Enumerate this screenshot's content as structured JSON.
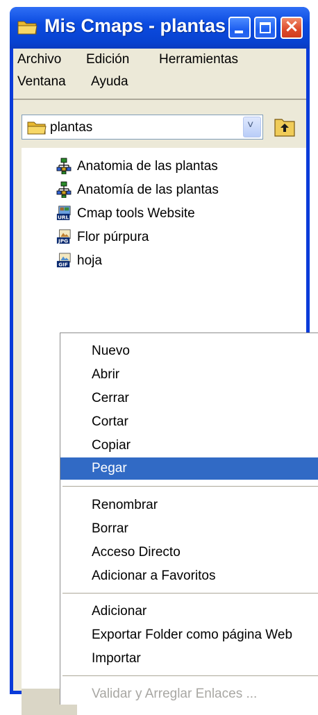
{
  "window": {
    "title": "Mis Cmaps - plantas",
    "icon": "folder-icon",
    "colors": {
      "titlebar": "#0b4be0",
      "close_button": "#dc4a2a",
      "menu_highlight": "#316ac5"
    }
  },
  "menubar": {
    "items": [
      "Archivo",
      "Edición",
      "Herramientas",
      "Ventana",
      "Ayuda"
    ]
  },
  "folder_selector": {
    "value": "plantas",
    "icon": "folder-icon",
    "dropdown_icon": "chevron-down-icon",
    "up_button_icon": "folder-up-icon"
  },
  "tree": {
    "items": [
      {
        "label": "Anatomia de las plantas",
        "icon": "cmap-icon"
      },
      {
        "label": "Anatomía de las plantas",
        "icon": "cmap-icon"
      },
      {
        "label": "Cmap tools Website",
        "icon": "url-icon"
      },
      {
        "label": "Flor púrpura",
        "icon": "jpg-icon"
      },
      {
        "label": "hoja",
        "icon": "gif-icon"
      }
    ]
  },
  "context_menu": {
    "groups": [
      [
        "Nuevo",
        "Abrir",
        "Cerrar",
        "Cortar",
        "Copiar",
        "Pegar"
      ],
      [
        "Renombrar",
        "Borrar",
        "Acceso Directo",
        "Adicionar a Favoritos"
      ],
      [
        "Adicionar",
        "Exportar Folder como página Web",
        "Importar"
      ],
      [
        "Validar y Arreglar Enlaces ..."
      ]
    ],
    "highlighted": "Pegar",
    "disabled": [
      "Validar y Arreglar Enlaces ..."
    ]
  }
}
